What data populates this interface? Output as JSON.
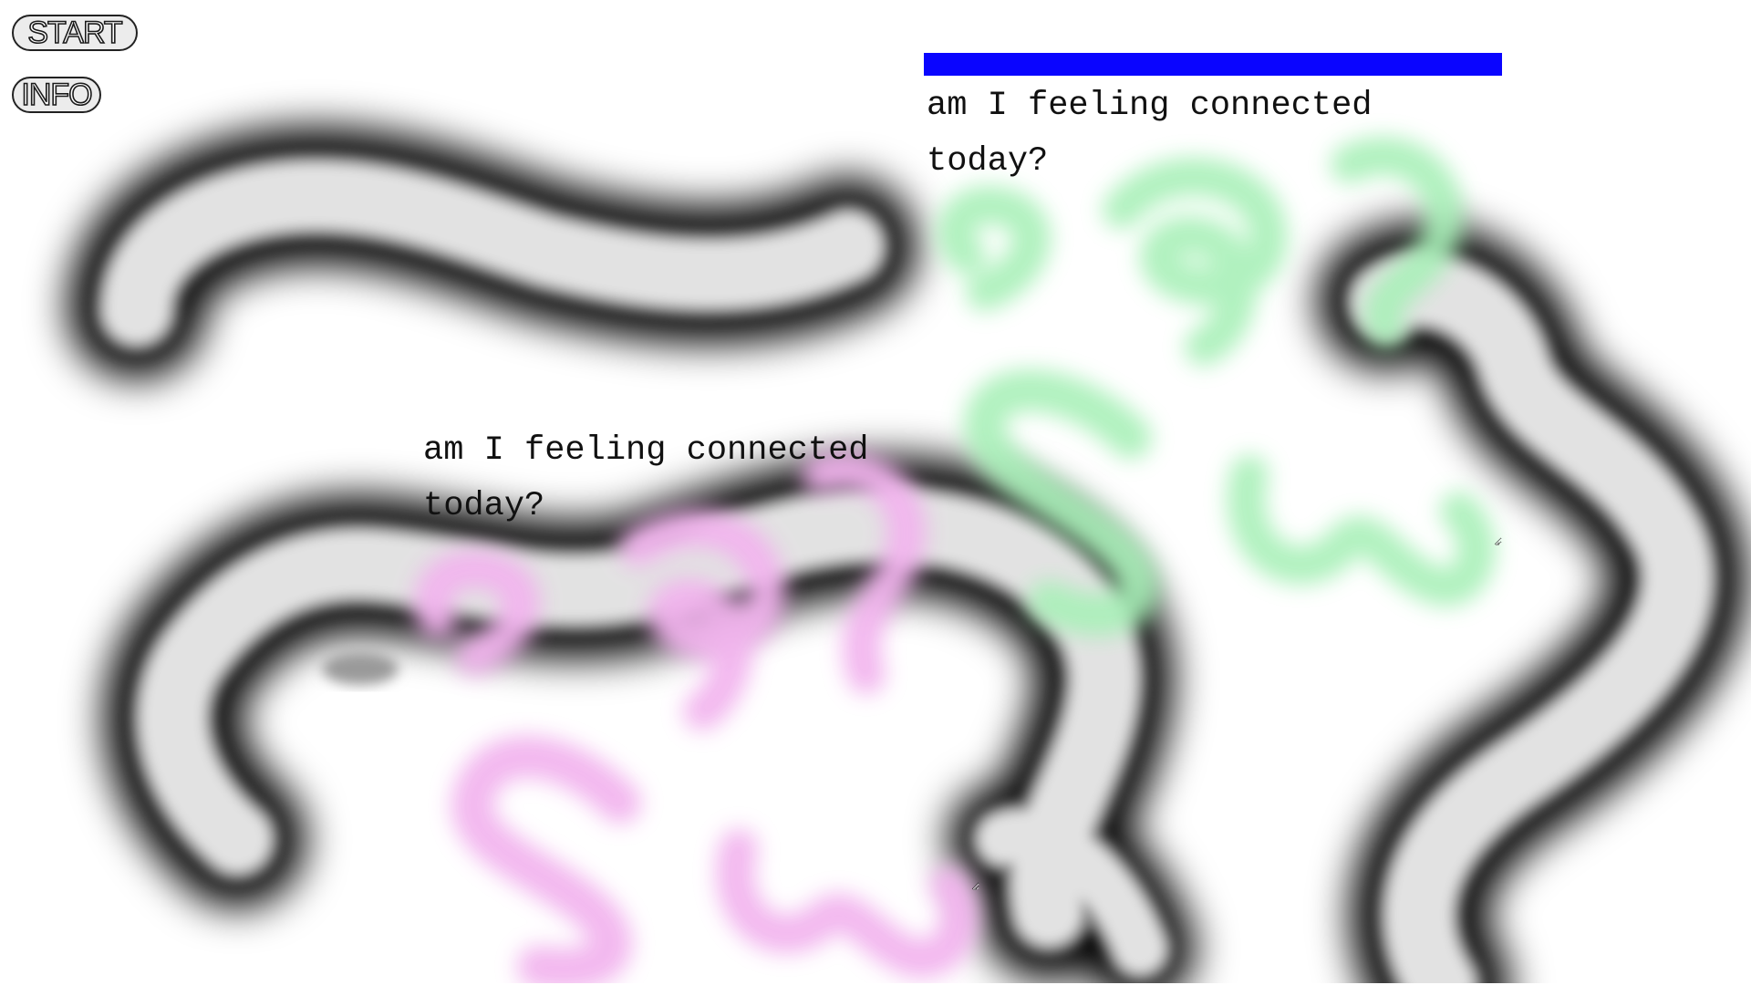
{
  "nav": {
    "start_label": "START",
    "info_label": "INFO"
  },
  "notes": [
    {
      "text": "am I feeling connected\ntoday?",
      "glow_color": "#a8f0b8",
      "header_color": "#0a05ff"
    },
    {
      "text": "am I feeling connected\ntoday?",
      "glow_color": "#f2b4ee"
    }
  ],
  "colors": {
    "background": "#ffffff",
    "blob_outline": "#000000",
    "blob_fill": "#e2e2e2"
  }
}
